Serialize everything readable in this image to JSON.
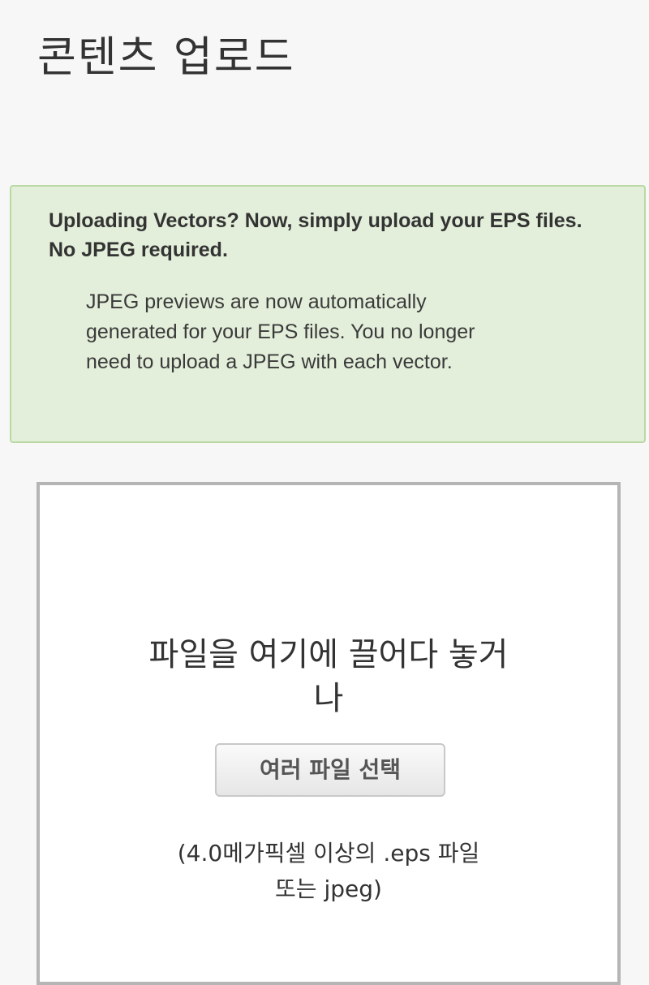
{
  "page": {
    "title": "콘텐츠 업로드"
  },
  "notice": {
    "heading": "Uploading Vectors? Now, simply upload your EPS files. No JPEG required.",
    "body": "JPEG previews are now automatically generated for your EPS files. You no longer need to upload a JPEG with each vector.",
    "colors": {
      "background": "#e3efda",
      "border": "#b9d9a3"
    }
  },
  "dropzone": {
    "drop_text": "파일을 여기에 끌어다 놓거나",
    "select_button_label": "여러 파일 선택",
    "hint": "(4.0메가픽셀 이상의 .eps 파일 또는 jpeg)"
  }
}
